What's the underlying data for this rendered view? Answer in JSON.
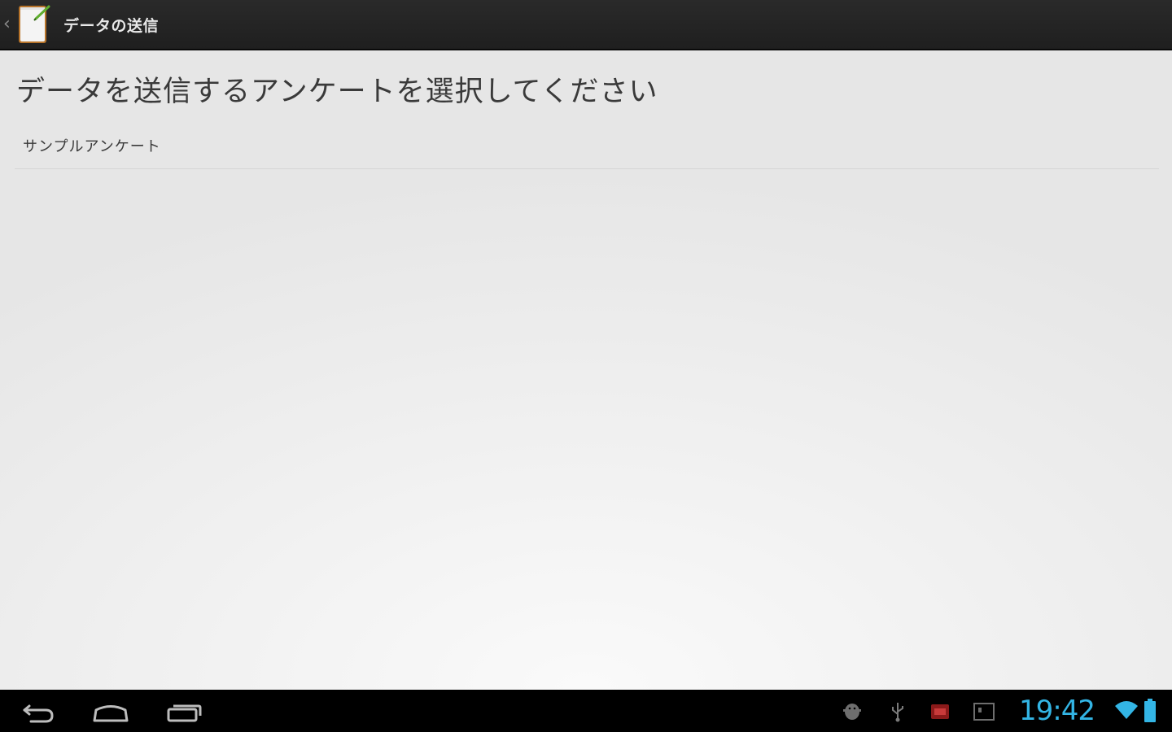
{
  "action_bar": {
    "title": "データの送信",
    "up_icon": "chevron-left-icon",
    "app_icon": "notepad-icon"
  },
  "main": {
    "prompt": "データを送信するアンケートを選択してください",
    "surveys": [
      {
        "label": "サンプルアンケート"
      }
    ]
  },
  "system_bar": {
    "clock": "19:42",
    "nav_icons": [
      "back-icon",
      "home-icon",
      "recent-apps-icon"
    ],
    "status_icons": [
      "debug-android-icon",
      "usb-icon",
      "notification-icon",
      "screenshot-icon",
      "wifi-icon",
      "battery-icon"
    ],
    "accent_color": "#33b5e5"
  }
}
